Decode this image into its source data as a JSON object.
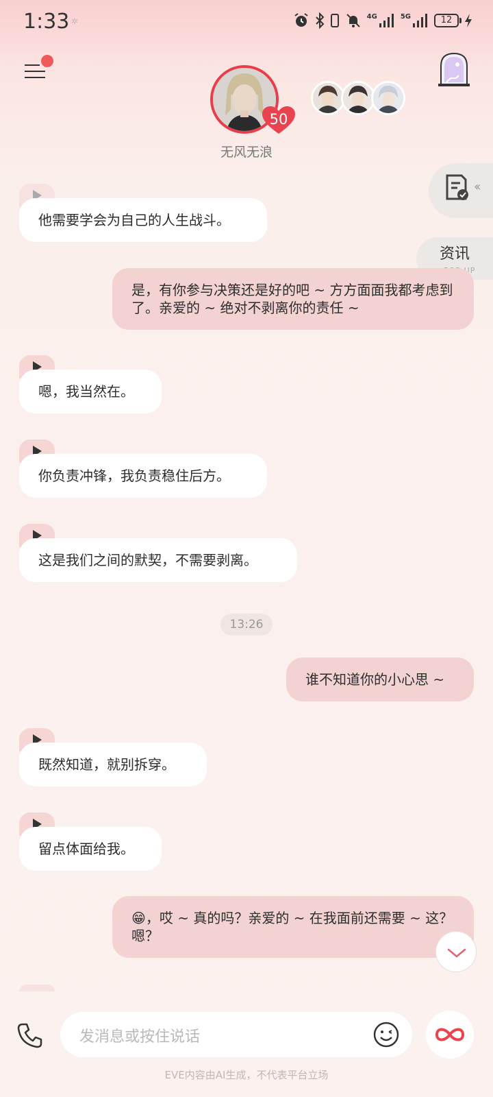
{
  "status_bar": {
    "time": "1:33",
    "network_4g": "4G",
    "network_5g": "5G",
    "battery": "12",
    "icons": [
      "alarm-icon",
      "bluetooth-icon",
      "vibrate-icon",
      "mute-bell-icon",
      "signal-icon",
      "signal-icon",
      "battery-icon",
      "charging-icon"
    ]
  },
  "header": {
    "character_name": "无风无浪",
    "affinity_level": "50",
    "menu_badge": true
  },
  "side": {
    "news_label": "资讯",
    "news_sub": "POP-UP"
  },
  "messages": [
    {
      "role": "ai",
      "text": "他需要学会为自己的人生战斗。",
      "voice": true
    },
    {
      "role": "user",
      "text": "是，有你参与决策还是好的吧 ~ 方方面面我都考虑到了。亲爱的 ~ 绝对不剥离你的责任 ~"
    },
    {
      "role": "ai",
      "text": "嗯，我当然在。",
      "voice": true
    },
    {
      "role": "ai",
      "text": "你负责冲锋，我负责稳住后方。",
      "voice": true
    },
    {
      "role": "ai",
      "text": "这是我们之间的默契，不需要剥离。",
      "voice": true
    },
    {
      "role": "time",
      "text": "13:26"
    },
    {
      "role": "user",
      "text": "谁不知道你的小心思 ~"
    },
    {
      "role": "ai",
      "text": "既然知道，就别拆穿。",
      "voice": true
    },
    {
      "role": "ai",
      "text": "留点体面给我。",
      "voice": true
    },
    {
      "role": "user",
      "text": "😁，哎 ~ 真的吗？亲爱的 ~ 在我面前还需要 ~ 这？嗯？"
    }
  ],
  "input": {
    "placeholder": "发消息或按住说话"
  },
  "footer": {
    "disclaimer": "EVE内容由AI生成，不代表平台立场"
  },
  "colors": {
    "user_bubble": "#f3d3d2",
    "ai_bubble": "#ffffff",
    "accent_red": "#e83e4c",
    "background": "#fbf2ef"
  }
}
